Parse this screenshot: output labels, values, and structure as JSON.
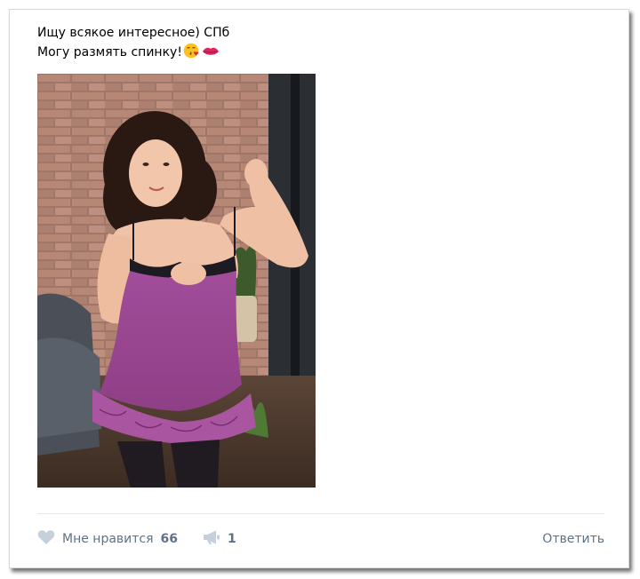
{
  "post": {
    "text_line_1": "Ищу всякое интересное) СПб",
    "text_line_2": "Могу размять спинку!",
    "emoji": [
      "kissing-face-emoji",
      "kiss-mark-emoji"
    ]
  },
  "photo": {
    "description": "photo-attachment"
  },
  "actions": {
    "like_label": "Мне нравится",
    "like_count": "66",
    "share_count": "1",
    "reply_label": "Ответить"
  },
  "colors": {
    "action_text": "#5f7285",
    "icon_gray": "#c5d0db",
    "divider": "#e7e8ec",
    "card_border": "#d3d8de"
  }
}
